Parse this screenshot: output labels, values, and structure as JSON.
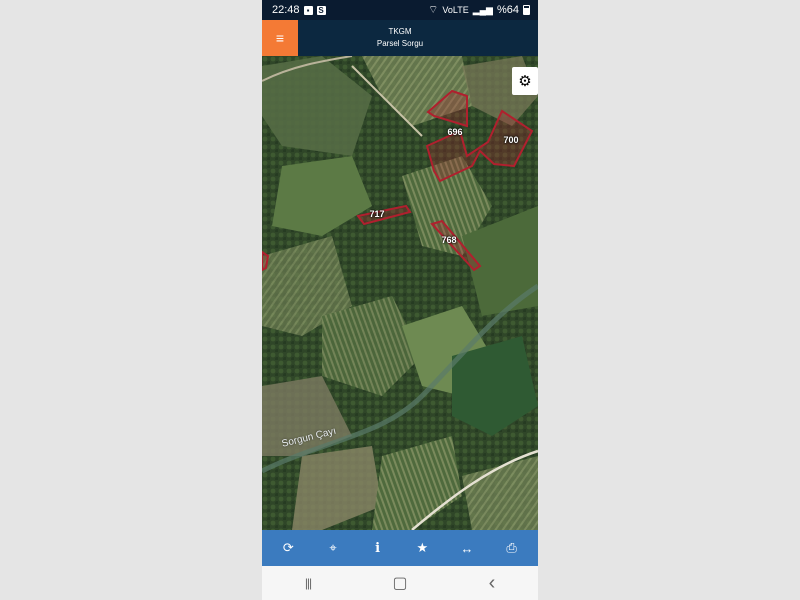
{
  "status_bar": {
    "time": "22:48",
    "notif_icons": [
      "image-icon",
      "s-app-icon"
    ],
    "wifi_label": "",
    "volte_label": "VoLTE",
    "battery": "%64"
  },
  "header": {
    "line1": "TKGM",
    "line2": "Parsel Sorgu",
    "menu_glyph": "≡",
    "accent_color": "#f47a35",
    "bg_color": "#0c2840"
  },
  "map": {
    "settings_glyph": "⚙",
    "river_label": "Sorgun Çayı",
    "parcels": [
      {
        "id": "696"
      },
      {
        "id": "700"
      },
      {
        "id": "717"
      },
      {
        "id": "768"
      }
    ],
    "parcel_color": "#b0202e"
  },
  "toolbar": {
    "bg_color": "#3b7bbf",
    "buttons": [
      {
        "icon": "refresh-icon",
        "glyph": "⟳"
      },
      {
        "icon": "locate-icon",
        "glyph": "⌖"
      },
      {
        "icon": "info-icon",
        "glyph": "i"
      },
      {
        "icon": "star-icon",
        "glyph": "★"
      },
      {
        "icon": "measure-icon",
        "glyph": "↔"
      },
      {
        "icon": "print-icon",
        "glyph": "⎙"
      }
    ]
  },
  "nav_bar": {
    "recent_glyph": "|||",
    "home_glyph": "▢",
    "back_glyph": "‹"
  }
}
